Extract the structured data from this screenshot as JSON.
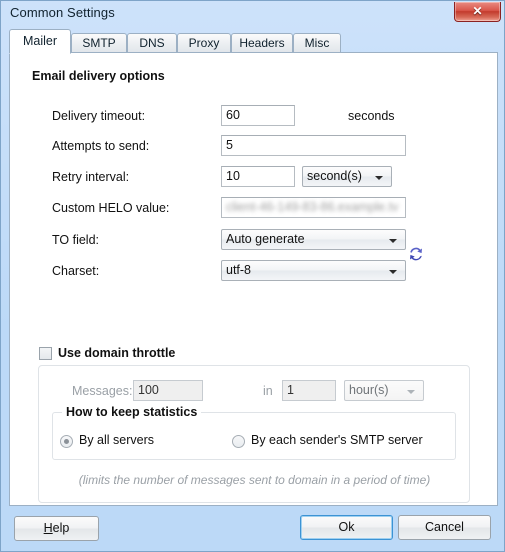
{
  "window": {
    "title": "Common Settings",
    "close_glyph": "✕",
    "close_label": "Close"
  },
  "tabs": [
    {
      "label": "Mailer",
      "active": true
    },
    {
      "label": "SMTP",
      "active": false
    },
    {
      "label": "DNS",
      "active": false
    },
    {
      "label": "Proxy",
      "active": false
    },
    {
      "label": "Headers",
      "active": false
    },
    {
      "label": "Misc",
      "active": false
    }
  ],
  "mailer": {
    "section_title": "Email delivery options",
    "delivery_timeout": {
      "label": "Delivery timeout:",
      "value": "60",
      "unit": "seconds"
    },
    "attempts_to_send": {
      "label": "Attempts to send:",
      "value": "5"
    },
    "retry_interval": {
      "label": "Retry interval:",
      "value": "10",
      "unit_selected": "second(s)"
    },
    "custom_helo": {
      "label": "Custom HELO value:",
      "value": "client-46-149-83-86.example.tv",
      "refresh_icon": "refresh-icon"
    },
    "to_field": {
      "label": "TO field:",
      "selected": "Auto generate"
    },
    "charset": {
      "label": "Charset:",
      "selected": "utf-8"
    }
  },
  "throttle": {
    "checkbox_label": "Use domain throttle",
    "checked": false,
    "messages": {
      "label": "Messages:",
      "value": "100"
    },
    "in_label": "in",
    "period": {
      "value": "1",
      "unit_selected": "hour(s)"
    },
    "statistics": {
      "legend": "How to keep statistics",
      "options": [
        {
          "label": "By all servers",
          "selected": true
        },
        {
          "label": "By each sender's SMTP server",
          "selected": false
        }
      ]
    },
    "hint": "(limits the number of messages sent to domain in a period of time)"
  },
  "buttons": {
    "help": {
      "accel": "H",
      "rest": "elp"
    },
    "ok": "Ok",
    "cancel": "Cancel"
  }
}
